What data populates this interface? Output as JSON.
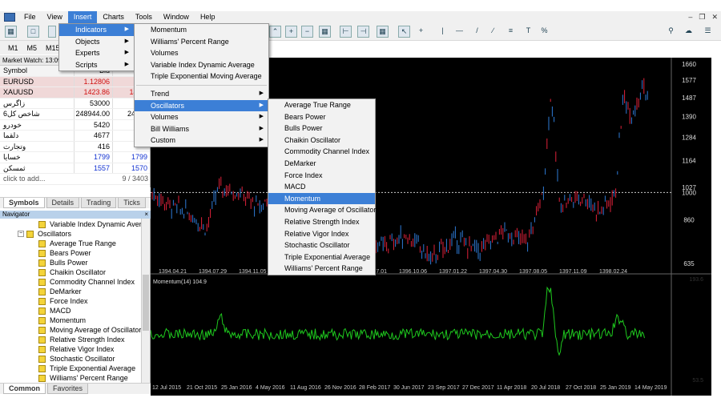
{
  "menubar": {
    "items": [
      "File",
      "View",
      "Insert",
      "Charts",
      "Tools",
      "Window",
      "Help"
    ],
    "active": "Insert"
  },
  "timeframes": [
    "M1",
    "M5",
    "M15"
  ],
  "market_watch": {
    "title": "Market Watch: 13:09",
    "columns": [
      "Symbol",
      "Bid",
      "Ask"
    ],
    "rows": [
      {
        "symbol": "EURUSD",
        "bid": "1.12806",
        "ask": "1.12",
        "bid_color": "red",
        "shade": true
      },
      {
        "symbol": "XAUUSD",
        "bid": "1423.86",
        "ask": "1423.",
        "bid_color": "red",
        "shade": true
      },
      {
        "symbol": "زاگرس",
        "bid": "53000",
        "ask": "5",
        "bid_color": "black",
        "shade": false
      },
      {
        "symbol": "شاخص کل6",
        "bid": "248944.00",
        "ask": "24894",
        "bid_color": "black",
        "shade": false
      },
      {
        "symbol": "خودرو",
        "bid": "5420",
        "ask": "5",
        "bid_color": "black",
        "shade": false
      },
      {
        "symbol": "دلقما",
        "bid": "4677",
        "ask": "4",
        "bid_color": "black",
        "shade": false
      },
      {
        "symbol": "وتجارت",
        "bid": "416",
        "ask": "",
        "bid_color": "black",
        "shade": false
      },
      {
        "symbol": "خسایا",
        "bid": "1799",
        "ask": "1799",
        "bid_color": "blue",
        "shade": false
      },
      {
        "symbol": "ثمسکن",
        "bid": "1557",
        "ask": "1570",
        "bid_color": "blue",
        "shade": false
      }
    ],
    "add_label": "click to add...",
    "count": "9 / 3403"
  },
  "mw_tabs": [
    "Symbols",
    "Details",
    "Trading",
    "Ticks"
  ],
  "navigator": {
    "title": "Navigator",
    "items": [
      {
        "label": "Variable Index Dynamic Average",
        "level": 2,
        "kind": "ind"
      },
      {
        "label": "Oscillators",
        "level": 1,
        "kind": "folder"
      },
      {
        "label": "Average True Range",
        "level": 2,
        "kind": "ind"
      },
      {
        "label": "Bears Power",
        "level": 2,
        "kind": "ind"
      },
      {
        "label": "Bulls Power",
        "level": 2,
        "kind": "ind"
      },
      {
        "label": "Chaikin Oscillator",
        "level": 2,
        "kind": "ind"
      },
      {
        "label": "Commodity Channel Index",
        "level": 2,
        "kind": "ind"
      },
      {
        "label": "DeMarker",
        "level": 2,
        "kind": "ind"
      },
      {
        "label": "Force Index",
        "level": 2,
        "kind": "ind"
      },
      {
        "label": "MACD",
        "level": 2,
        "kind": "ind"
      },
      {
        "label": "Momentum",
        "level": 2,
        "kind": "ind"
      },
      {
        "label": "Moving Average of Oscillator",
        "level": 2,
        "kind": "ind"
      },
      {
        "label": "Relative Strength Index",
        "level": 2,
        "kind": "ind"
      },
      {
        "label": "Relative Vigor Index",
        "level": 2,
        "kind": "ind"
      },
      {
        "label": "Stochastic Oscillator",
        "level": 2,
        "kind": "ind"
      },
      {
        "label": "Triple Exponential Average",
        "level": 2,
        "kind": "ind"
      },
      {
        "label": "Williams' Percent Range",
        "level": 2,
        "kind": "ind"
      }
    ]
  },
  "nav_tabs": [
    "Common",
    "Favorites"
  ],
  "insert_menu": [
    {
      "label": "Indicators",
      "sub": true,
      "hl": true
    },
    {
      "label": "Objects",
      "sub": true
    },
    {
      "label": "Experts",
      "sub": true
    },
    {
      "label": "Scripts",
      "sub": true
    }
  ],
  "indicators_menu": [
    {
      "label": "Momentum"
    },
    {
      "label": "Williams' Percent Range"
    },
    {
      "label": "Volumes"
    },
    {
      "label": "Variable Index Dynamic Average"
    },
    {
      "label": "Triple Exponential Moving Average"
    },
    {
      "sep": true
    },
    {
      "label": "Trend",
      "sub": true
    },
    {
      "label": "Oscillators",
      "sub": true,
      "hl": true
    },
    {
      "label": "Volumes",
      "sub": true
    },
    {
      "label": "Bill Williams",
      "sub": true
    },
    {
      "label": "Custom",
      "sub": true
    }
  ],
  "oscillators_menu": [
    {
      "label": "Average True Range"
    },
    {
      "label": "Bears Power"
    },
    {
      "label": "Bulls Power"
    },
    {
      "label": "Chaikin Oscillator"
    },
    {
      "label": "Commodity Channel Index"
    },
    {
      "label": "DeMarker"
    },
    {
      "label": "Force Index"
    },
    {
      "label": "MACD"
    },
    {
      "label": "Momentum",
      "hl": true
    },
    {
      "label": "Moving Average of Oscillator"
    },
    {
      "label": "Relative Strength Index"
    },
    {
      "label": "Relative Vigor Index"
    },
    {
      "label": "Stochastic Oscillator"
    },
    {
      "label": "Triple Exponential Average"
    },
    {
      "label": "Williams' Percent Range"
    }
  ],
  "price_chart": {
    "price_levels": [
      "1660",
      "1577",
      "1487",
      "1390",
      "1284",
      "1164",
      "1027",
      "1000",
      "860",
      "635"
    ],
    "date_labels": [
      "1394.04.21",
      "1394.07.29",
      "1394.11.05",
      "1395",
      "1396.03.29",
      "1396.07.01",
      "1396.10.06",
      "1397.01.22",
      "1397.04.30",
      "1397.08.05",
      "1397.11.09",
      "1398.02.24"
    ],
    "level_line": 1000,
    "bull_color": "#2e7bd6",
    "bear_color": "#e0213a"
  },
  "momentum": {
    "label": "Momentum(14) 104.9",
    "scale_top": "193.6",
    "scale_bottom": "53.5",
    "line_color": "#1ec81e",
    "date_labels": [
      "12 Jul 2015",
      "21 Oct 2015",
      "25 Jan 2016",
      "4 May 2016",
      "11 Aug 2016",
      "26 Nov 2016",
      "28 Feb 2017",
      "30 Jun 2017",
      "23 Sep 2017",
      "27 Dec 2017",
      "11 Apr 2018",
      "20 Jul 2018",
      "27 Oct 2018",
      "25 Jan 2019",
      "14 May 2019"
    ]
  },
  "icons": [
    "terminal-logo-icon",
    "new-chart-icon",
    "profiles-icon",
    "search-icon",
    "chat-icon",
    "crosshair-icon",
    "cursor-icon"
  ]
}
